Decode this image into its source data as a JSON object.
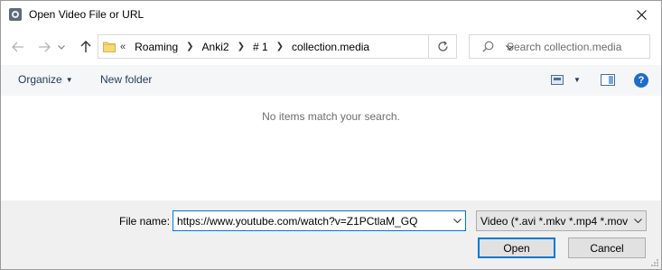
{
  "window": {
    "title": "Open Video File or URL"
  },
  "icons": {
    "app": "video-app-icon",
    "close": "close-icon",
    "back": "back-arrow-icon",
    "forward": "forward-arrow-icon",
    "recent": "chevron-down-icon",
    "up": "up-arrow-icon",
    "folder": "folder-icon",
    "refresh": "refresh-icon",
    "search": "search-icon",
    "views": "change-view-icon",
    "preview_pane": "preview-pane-icon",
    "help": "help-icon"
  },
  "address": {
    "overflow": "«",
    "crumbs": [
      "Roaming",
      "Anki2",
      "# 1",
      "collection.media"
    ]
  },
  "search": {
    "placeholder": "Search collection.media"
  },
  "commands": {
    "organize": "Organize",
    "new_folder": "New folder",
    "help": "?"
  },
  "content": {
    "empty_message": "No items match your search."
  },
  "footer": {
    "file_name_label": "File name:",
    "file_name_value": "https://www.youtube.com/watch?v=Z1PCtlaM_GQ",
    "filter": "Video (*.avi *.mkv *.mp4 *.mov",
    "open_label": "Open",
    "cancel_label": "Cancel"
  },
  "colors": {
    "accent": "#0078d7",
    "link_text": "#1e395b",
    "panel_bg": "#f0f0f0"
  }
}
